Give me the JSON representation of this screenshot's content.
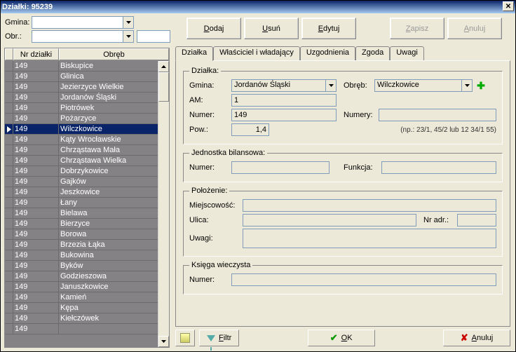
{
  "window": {
    "title": "Działki: 95239"
  },
  "filters": {
    "gmina_label": "Gmina:",
    "obr_label": "Obr.:",
    "gmina_value": "",
    "obr_value": "",
    "obr2_value": ""
  },
  "toolbar": {
    "dodaj": "Dodaj",
    "usun": "Usuń",
    "edytuj": "Edytuj",
    "zapisz": "Zapisz",
    "anuluj": "Anuluj"
  },
  "grid": {
    "col_nr": "Nr działki",
    "col_obreb": "Obręb",
    "rows": [
      {
        "nr": "149",
        "obreb": "Biskupice"
      },
      {
        "nr": "149",
        "obreb": "Glinica"
      },
      {
        "nr": "149",
        "obreb": "Jezierzyce Wielkie"
      },
      {
        "nr": "149",
        "obreb": "Jordanów Śląski"
      },
      {
        "nr": "149",
        "obreb": "Piotrówek"
      },
      {
        "nr": "149",
        "obreb": "Pożarzyce"
      },
      {
        "nr": "149",
        "obreb": "Wilczkowice"
      },
      {
        "nr": "149",
        "obreb": "Kąty Wrocławskie"
      },
      {
        "nr": "149",
        "obreb": "Chrząstawa Mała"
      },
      {
        "nr": "149",
        "obreb": "Chrząstawa Wielka"
      },
      {
        "nr": "149",
        "obreb": "Dobrzykowice"
      },
      {
        "nr": "149",
        "obreb": "Gajków"
      },
      {
        "nr": "149",
        "obreb": "Jeszkowice"
      },
      {
        "nr": "149",
        "obreb": "Łany"
      },
      {
        "nr": "149",
        "obreb": "Bielawa"
      },
      {
        "nr": "149",
        "obreb": "Bierzyce"
      },
      {
        "nr": "149",
        "obreb": "Borowa"
      },
      {
        "nr": "149",
        "obreb": "Brzezia Łąka"
      },
      {
        "nr": "149",
        "obreb": "Bukowina"
      },
      {
        "nr": "149",
        "obreb": "Byków"
      },
      {
        "nr": "149",
        "obreb": "Godzieszowa"
      },
      {
        "nr": "149",
        "obreb": "Januszkowice"
      },
      {
        "nr": "149",
        "obreb": "Kamień"
      },
      {
        "nr": "149",
        "obreb": "Kępa"
      },
      {
        "nr": "149",
        "obreb": "Kiełczówek"
      },
      {
        "nr": "149",
        "obreb": ""
      }
    ],
    "selected_index": 6
  },
  "tabs": {
    "dzialka": "Działka",
    "wlasciciel": "Właściciel i władający",
    "uzgodnienia": "Uzgodnienia",
    "zgoda": "Zgoda",
    "uwagi": "Uwagi"
  },
  "dzialka": {
    "legend": "Działka:",
    "gmina_label": "Gmina:",
    "gmina_value": "Jordanów Śląski",
    "obreb_label": "Obręb:",
    "obreb_value": "Wilczkowice",
    "am_label": "AM:",
    "am_value": "1",
    "numer_label": "Numer:",
    "numer_value": "149",
    "numery_label": "Numery:",
    "numery_value": "",
    "pow_label": "Pow.:",
    "pow_value": "1,4",
    "hint": "(np.: 23/1, 45/2 lub 12 34/1 55)"
  },
  "jb": {
    "legend": "Jednostka bilansowa:",
    "numer_label": "Numer:",
    "numer_value": "",
    "funkcja_label": "Funkcja:",
    "funkcja_value": ""
  },
  "pol": {
    "legend": "Położenie:",
    "miejsc_label": "Miejscowość:",
    "miejsc_value": "",
    "ulica_label": "Ulica:",
    "ulica_value": "",
    "nradr_label": "Nr adr.:",
    "nradr_value": "",
    "uwagi_label": "Uwagi:",
    "uwagi_value": ""
  },
  "kw": {
    "legend": "Księga wieczysta",
    "numer_label": "Numer:",
    "numer_value": ""
  },
  "bottom": {
    "filtr": "Filtr",
    "ok": "OK",
    "anuluj": "Anuluj"
  }
}
